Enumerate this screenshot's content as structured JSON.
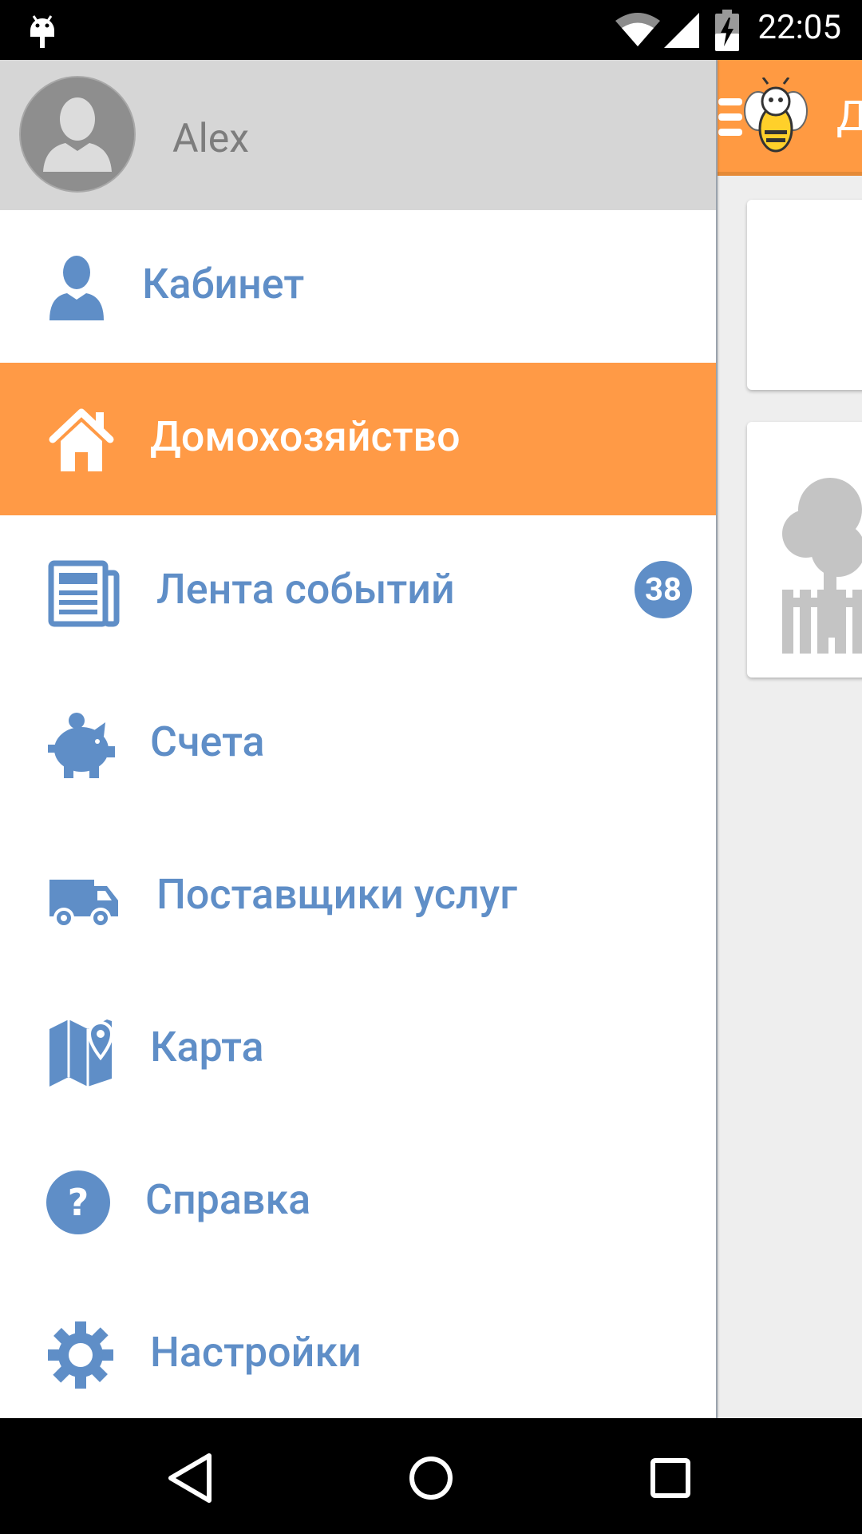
{
  "status_bar": {
    "time": "22:05",
    "icons": [
      "android-debug-icon",
      "wifi-icon",
      "signal-icon",
      "battery-charging-icon"
    ]
  },
  "app_bar": {
    "title": "Д",
    "icons": [
      "menu-icon",
      "bee-logo-icon"
    ]
  },
  "drawer": {
    "profile": {
      "name": "Alex",
      "avatar": "user-avatar-placeholder"
    },
    "items": [
      {
        "label": "Кабинет",
        "icon": "user-icon",
        "active": false
      },
      {
        "label": "Домохозяйство",
        "icon": "home-icon",
        "active": true
      },
      {
        "label": "Лента событий",
        "icon": "newspaper-icon",
        "active": false,
        "badge": "38"
      },
      {
        "label": "Счета",
        "icon": "piggy-bank-icon",
        "active": false
      },
      {
        "label": "Поставщики услуг",
        "icon": "truck-icon",
        "active": false
      },
      {
        "label": "Карта",
        "icon": "map-icon",
        "active": false
      },
      {
        "label": "Справка",
        "icon": "help-icon",
        "active": false
      },
      {
        "label": "Настройки",
        "icon": "gear-icon",
        "active": false
      }
    ]
  },
  "nav_bar": {
    "buttons": [
      "back-icon",
      "home-circle-icon",
      "recents-icon"
    ]
  },
  "colors": {
    "accent": "#ff9a42",
    "menu_text": "#5f8ec7",
    "active_bg": "#ff9a46",
    "profile_bg": "#d6d6d6"
  }
}
